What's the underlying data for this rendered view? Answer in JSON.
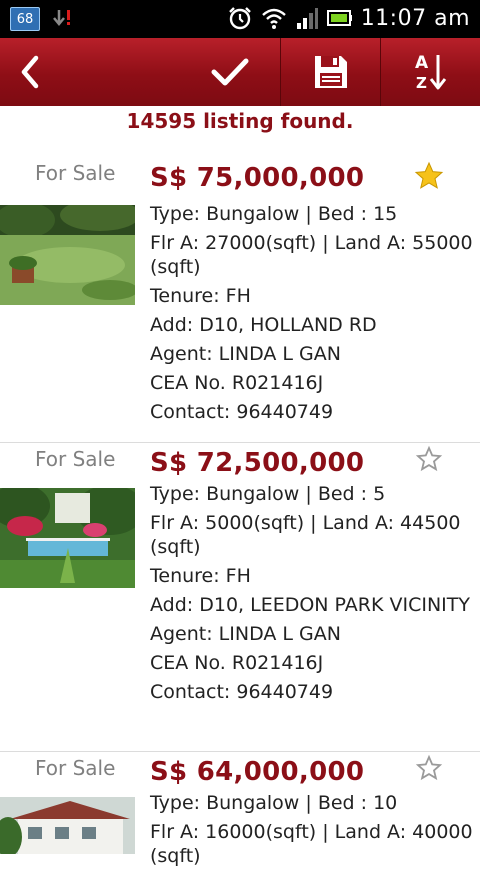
{
  "status_bar": {
    "notification_count": "68",
    "time": "11:07 am"
  },
  "action_bar": {
    "back_icon": "chevron-left-icon",
    "confirm_icon": "check-icon",
    "save_icon": "floppy-disk-icon",
    "sort_icon": "sort-az-icon"
  },
  "results": {
    "count_text": "14595 listing found."
  },
  "colors": {
    "brand": "#8b0f17",
    "action_bar_top": "#b8202a",
    "action_bar_bottom": "#7d0b12"
  },
  "listings": [
    {
      "status": "For Sale",
      "price": "S$ 75,000,000",
      "favorite": true,
      "type_line": "Type: Bungalow  |  Bed : 15",
      "area_line": "Flr A: 27000(sqft) | Land A: 55000 (sqft)",
      "tenure": "Tenure: FH",
      "address": "Add: D10,  HOLLAND RD",
      "agent": "Agent: LINDA L GAN",
      "cea": "CEA No. R021416J",
      "contact": "Contact: 96440749"
    },
    {
      "status": "For Sale",
      "price": "S$ 72,500,000",
      "favorite": false,
      "type_line": "Type: Bungalow  |  Bed : 5",
      "area_line": "Flr A: 5000(sqft) | Land A: 44500 (sqft)",
      "tenure": "Tenure: FH",
      "address": "Add: D10,  LEEDON PARK VICINITY",
      "agent": "Agent: LINDA L GAN",
      "cea": "CEA No. R021416J",
      "contact": "Contact: 96440749"
    },
    {
      "status": "For Sale",
      "price": "S$ 64,000,000",
      "favorite": false,
      "type_line": "Type: Bungalow  |  Bed : 10",
      "area_line": "Flr A: 16000(sqft) | Land A: 40000 (sqft)"
    }
  ]
}
